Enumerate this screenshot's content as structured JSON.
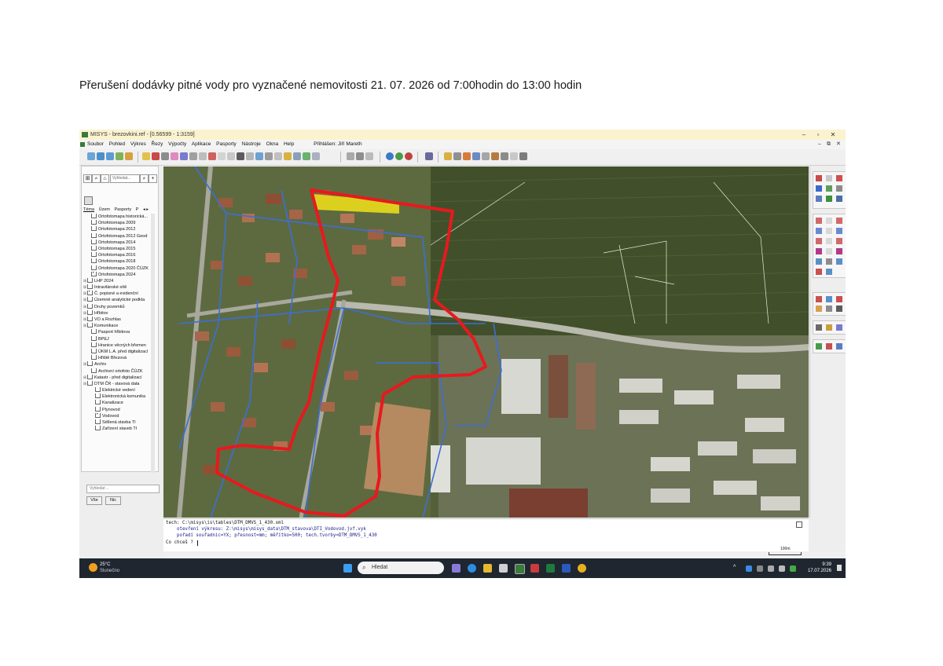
{
  "document": {
    "title": "Přerušení dodávky pitné vody pro vyznačené nemovitosti 21. 07. 2026 od 7:00hodin do 13:00 hodin"
  },
  "window": {
    "title": "MISYS - brezovkini.ref - [0.56599 - 1:3159]",
    "controls": {
      "minimize": "–",
      "maximize": "▫",
      "close": "✕"
    },
    "mdi_controls": {
      "minimize": "–",
      "restore": "⧉",
      "close": "✕"
    }
  },
  "menu": {
    "items": [
      "Soubor",
      "Pohled",
      "Výkres",
      "Řezy",
      "Výpočty",
      "Aplikace",
      "Pasporty",
      "Nástroje",
      "Okna",
      "Help"
    ],
    "user": "Přihlášen: Jiří Mareth"
  },
  "left_panel": {
    "search_placeholder": "Vyhledat...",
    "tabs": [
      "Téma",
      "Územ",
      "Pasporty",
      "P"
    ],
    "layers": [
      {
        "label": "Ortofotomapa historická...",
        "checked": false,
        "indent": 1
      },
      {
        "label": "Ortofotomapa 2009",
        "checked": false,
        "indent": 1
      },
      {
        "label": "Ortofotomapa 2012",
        "checked": false,
        "indent": 1
      },
      {
        "label": "Ortofotomapa 2012 Geod",
        "checked": false,
        "indent": 1
      },
      {
        "label": "Ortofotomapa 2014",
        "checked": false,
        "indent": 1
      },
      {
        "label": "Ortofotomapa 2015",
        "checked": false,
        "indent": 1
      },
      {
        "label": "Ortofotomapa 2016",
        "checked": false,
        "indent": 1
      },
      {
        "label": "Ortofotomapa 2018",
        "checked": false,
        "indent": 1
      },
      {
        "label": "Ortofotomapa 2020 ČÚZK",
        "checked": false,
        "indent": 1
      },
      {
        "label": "Ortofotomapa 2024",
        "checked": true,
        "indent": 1
      },
      {
        "label": "LHP 2024",
        "checked": false,
        "indent": 0
      },
      {
        "label": "Intravilánské sítě",
        "checked": false,
        "indent": 0
      },
      {
        "label": "Č. popisné a evidenční",
        "checked": true,
        "indent": 0
      },
      {
        "label": "Územně analytické podkla",
        "checked": false,
        "indent": 0
      },
      {
        "label": "Druhy pozemků",
        "checked": false,
        "indent": 0
      },
      {
        "label": "Hřbitov",
        "checked": false,
        "indent": 0
      },
      {
        "label": "VO a Rozhlas",
        "checked": false,
        "indent": 0
      },
      {
        "label": "Komunikace",
        "checked": false,
        "indent": 0
      },
      {
        "label": "Pasport hřbitova",
        "checked": false,
        "indent": 1
      },
      {
        "label": "BPEJ",
        "checked": false,
        "indent": 1
      },
      {
        "label": "Hranice věcných břemen",
        "checked": false,
        "indent": 1
      },
      {
        "label": "ÚKM L.A. před digitalizací",
        "checked": false,
        "indent": 1
      },
      {
        "label": "Hřiště Březová",
        "checked": false,
        "indent": 1
      },
      {
        "label": "Archiv",
        "checked": false,
        "indent": 0
      },
      {
        "label": "Archivní ortofoto ČÚZK",
        "checked": false,
        "indent": 1
      },
      {
        "label": "Katastr - před digitalizací",
        "checked": false,
        "indent": 0
      },
      {
        "label": "DTM ČR - stavová data",
        "checked": false,
        "indent": 0
      },
      {
        "label": "Elektrické vedení",
        "checked": false,
        "indent": 2
      },
      {
        "label": "Elektronická komunika",
        "checked": false,
        "indent": 2
      },
      {
        "label": "Kanalizace",
        "checked": false,
        "indent": 2
      },
      {
        "label": "Plynovod",
        "checked": false,
        "indent": 2
      },
      {
        "label": "Vodovod",
        "checked": true,
        "indent": 2
      },
      {
        "label": "Sdílená stavba TI",
        "checked": false,
        "indent": 2
      },
      {
        "label": "Zařízení staveb TI",
        "checked": false,
        "indent": 2
      }
    ],
    "bottom_search_placeholder": "Vyhledat ...",
    "btn_all": "Vše",
    "btn_none": "Nic"
  },
  "console": {
    "lines": [
      "tech: C:\\misys\\is\\tables\\DTM_DMVS_1_430.xml",
      "    otevření výkresu: Z:\\misys\\misys_data\\DTM_stavova\\DTI_Vodovod.jvf.vyk",
      "    pořadí souřadnic=YX; přesnost=mm; měřítko=500; tech.tvorby=DTM_DMVS_1_430",
      "Co chceš ? "
    ]
  },
  "status": {
    "scale_label": "100m"
  },
  "taskbar": {
    "weather_temp": "25°C",
    "weather_desc": "Slunečno",
    "search_placeholder": "Hledat",
    "time": "9:39",
    "date": "17.07.2026"
  },
  "colors": {
    "outage_outline": "#e8191e",
    "water_pipe": "#3b6fd6",
    "highlight_yellow": "#f2e21a"
  }
}
